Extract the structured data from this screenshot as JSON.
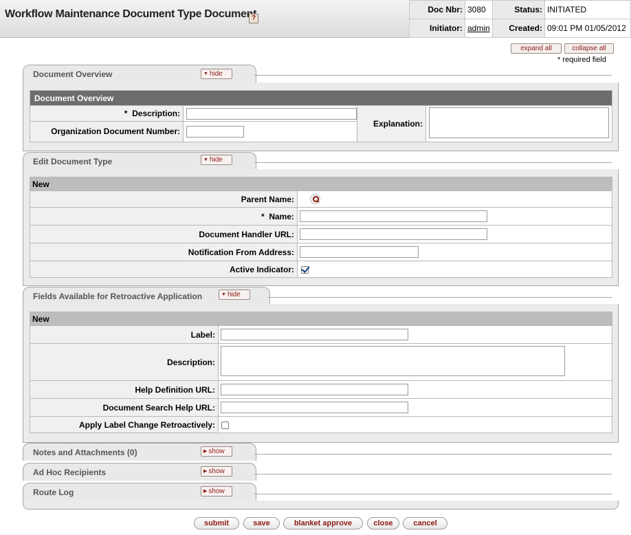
{
  "header": {
    "title": "Workflow Maintenance Document Type Document",
    "help_glyph": "?",
    "doc_nbr_label": "Doc Nbr:",
    "doc_nbr": "3080",
    "status_label": "Status:",
    "status": "INITIATED",
    "initiator_label": "Initiator:",
    "initiator": "admin",
    "created_label": "Created:",
    "created": "09:01 PM 01/05/2012"
  },
  "controls": {
    "expand_all": "expand all",
    "collapse_all": "collapse all",
    "required_note": "* required field"
  },
  "doc_overview": {
    "tab_label": "Document Overview",
    "toggle": "hide",
    "header": "Document Overview",
    "description_label": "Description:",
    "required_mark": "*",
    "org_doc_number_label": "Organization Document Number:",
    "explanation_label": "Explanation:",
    "description_value": "",
    "org_doc_number_value": "",
    "explanation_value": ""
  },
  "edit_doc_type": {
    "tab_label": "Edit Document Type",
    "toggle": "hide",
    "new_label": "New",
    "parent_name_label": "Parent Name:",
    "name_label": "Name:",
    "required_mark": "*",
    "handler_url_label": "Document Handler URL:",
    "notification_label": "Notification From Address:",
    "active_label": "Active Indicator:",
    "active_checked": true,
    "name_value": "",
    "handler_url_value": "",
    "notification_value": ""
  },
  "retro_fields": {
    "tab_label": "Fields Available for Retroactive Application",
    "toggle": "hide",
    "new_label": "New",
    "label_label": "Label:",
    "description_label": "Description:",
    "help_url_label": "Help Definition URL:",
    "search_help_label": "Document Search Help URL:",
    "apply_retro_label": "Apply Label Change Retroactively:",
    "apply_retro_checked": false
  },
  "collapsed_tabs": [
    {
      "label": "Notes and Attachments (0)",
      "toggle": "show"
    },
    {
      "label": "Ad Hoc Recipients",
      "toggle": "show"
    },
    {
      "label": "Route Log",
      "toggle": "show"
    }
  ],
  "buttons": {
    "submit": "submit",
    "save": "save",
    "blanket_approve": "blanket approve",
    "close": "close",
    "cancel": "cancel"
  },
  "colors": {
    "accent": "#8b1a10",
    "section_header": "#6d6d6d",
    "new_row": "#bdbdbd",
    "check": "#16427a"
  }
}
